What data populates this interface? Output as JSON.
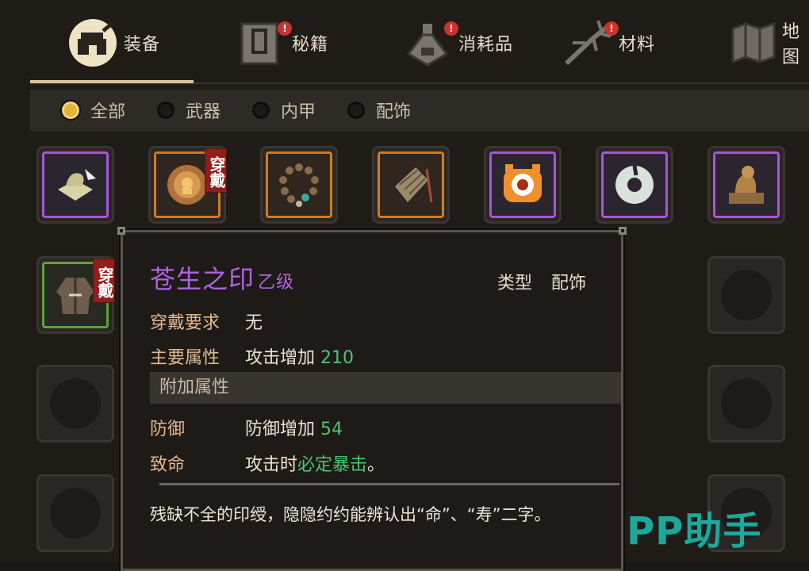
{
  "tabs": [
    {
      "label": "装备",
      "icon": "equipment-icon",
      "badge": ""
    },
    {
      "label": "秘籍",
      "icon": "book-icon",
      "badge": "!"
    },
    {
      "label": "消耗品",
      "icon": "potion-icon",
      "badge": "!"
    },
    {
      "label": "材料",
      "icon": "herb-icon",
      "badge": "!"
    },
    {
      "label": "地图",
      "icon": "map-icon",
      "badge": ""
    }
  ],
  "filters": [
    {
      "label": "全部",
      "selected": true
    },
    {
      "label": "武器",
      "selected": false
    },
    {
      "label": "内甲",
      "selected": false
    },
    {
      "label": "配饰",
      "selected": false
    }
  ],
  "worn_badge": "穿戴",
  "tooltip": {
    "name": "苍生之印",
    "grade": "乙级",
    "type_label": "类型",
    "type_value": "配饰",
    "requirement_label": "穿戴要求",
    "requirement_value": "无",
    "main_attr_label": "主要属性",
    "main_attr_text": "攻击增加",
    "main_attr_value": "210",
    "extra_section": "附加属性",
    "defense_label": "防御",
    "defense_text": "防御增加",
    "defense_value": "54",
    "fatal_label": "致命",
    "fatal_prefix": "攻击时",
    "fatal_effect": "必定暴击",
    "fatal_suffix": "。",
    "description": "残缺不全的印绶，隐隐约约能辨认出“命”、“寿”二字。"
  },
  "watermark": "PP助手",
  "colors": {
    "purple": "#a656d6",
    "orange": "#d27a23",
    "green_frame": "#5aa339",
    "stat_green": "#4cc76d",
    "badge_red": "#8f1f1d"
  }
}
